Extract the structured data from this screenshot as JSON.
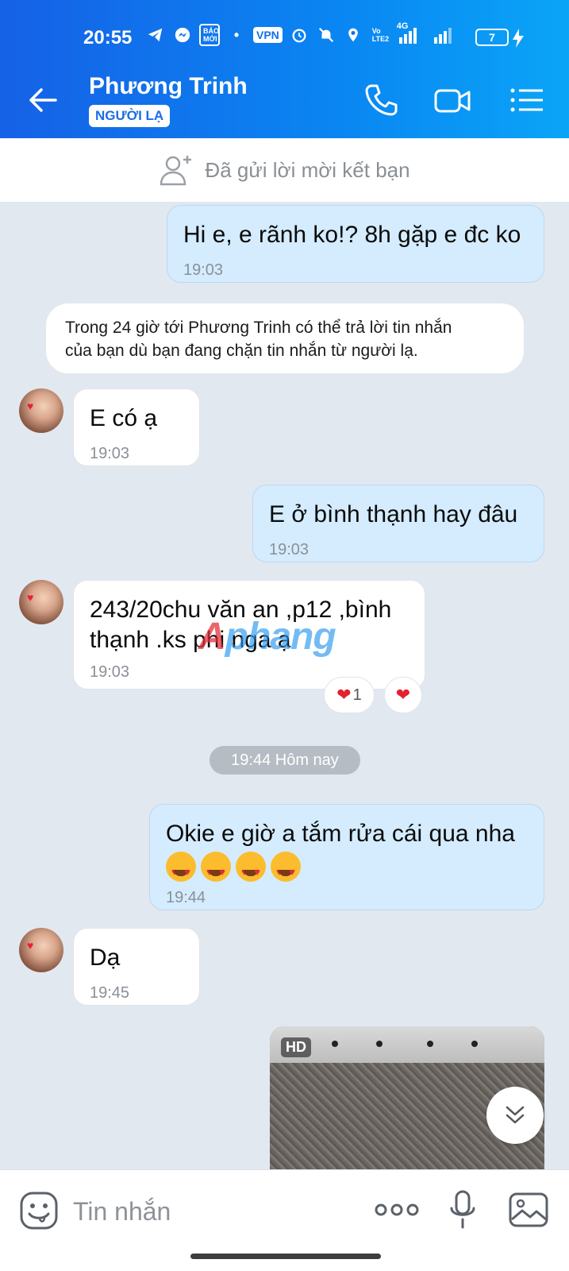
{
  "status_bar": {
    "time": "20:55",
    "vpn": "VPN",
    "volte": "Vo LTE2",
    "network": "4G",
    "battery": "7",
    "news_badge": "BÁO MỚI"
  },
  "header": {
    "contact_name": "Phương Trinh",
    "badge": "NGƯỜI LẠ"
  },
  "friend_bar": {
    "text": "Đã gửi lời mời kết bạn"
  },
  "messages": [
    {
      "text": "Hi e, e rãnh ko!? 8h gặp e đc ko",
      "time": "19:03"
    },
    {
      "text": "E có ạ",
      "time": "19:03"
    },
    {
      "text": "E ở bình thạnh hay đâu",
      "time": "19:03"
    },
    {
      "line1": "243/20chu văn an ,p12 ,bình",
      "line2": "thạnh .ks phi nga ạ",
      "time": "19:03"
    },
    {
      "text": "Okie e giờ a tắm rửa cái qua nha",
      "time": "19:44"
    },
    {
      "text": "Dạ",
      "time": "19:45"
    }
  ],
  "notice": {
    "line1": "Trong 24 giờ tới Phương Trinh có thể trả lời tin nhắn",
    "line2": "của bạn dù bạn đang chặn tin nhắn từ người lạ."
  },
  "reactions": {
    "count": "1"
  },
  "date_separator": "19:44 Hôm nay",
  "photo": {
    "badge": "HD"
  },
  "watermark": {
    "a": "A",
    "rest": "phang"
  },
  "composer": {
    "placeholder": "Tin nhắn"
  },
  "colors": {
    "header_start": "#1661e6",
    "header_end": "#0aa5f7",
    "my_bubble": "#d4ecfe",
    "their_bubble": "#ffffff",
    "chat_bg": "#e2e8ef"
  }
}
